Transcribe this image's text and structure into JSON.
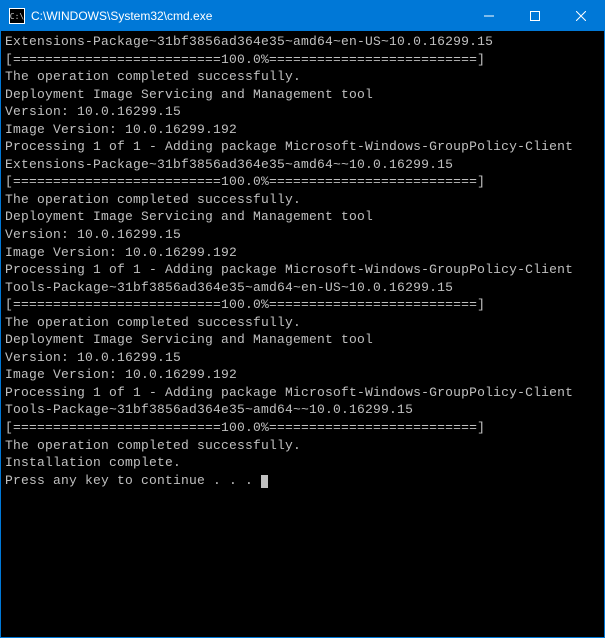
{
  "titlebar": {
    "icon_label": "C:\\",
    "title": "C:\\WINDOWS\\System32\\cmd.exe"
  },
  "terminal": {
    "lines": [
      "Extensions-Package~31bf3856ad364e35~amd64~en-US~10.0.16299.15",
      "[==========================100.0%==========================]",
      "The operation completed successfully.",
      "",
      "Deployment Image Servicing and Management tool",
      "Version: 10.0.16299.15",
      "",
      "Image Version: 10.0.16299.192",
      "",
      "Processing 1 of 1 - Adding package Microsoft-Windows-GroupPolicy-Client",
      "Extensions-Package~31bf3856ad364e35~amd64~~10.0.16299.15",
      "[==========================100.0%==========================]",
      "The operation completed successfully.",
      "",
      "Deployment Image Servicing and Management tool",
      "Version: 10.0.16299.15",
      "",
      "Image Version: 10.0.16299.192",
      "",
      "Processing 1 of 1 - Adding package Microsoft-Windows-GroupPolicy-Client",
      "Tools-Package~31bf3856ad364e35~amd64~en-US~10.0.16299.15",
      "[==========================100.0%==========================]",
      "The operation completed successfully.",
      "",
      "Deployment Image Servicing and Management tool",
      "Version: 10.0.16299.15",
      "",
      "Image Version: 10.0.16299.192",
      "",
      "Processing 1 of 1 - Adding package Microsoft-Windows-GroupPolicy-Client",
      "Tools-Package~31bf3856ad364e35~amd64~~10.0.16299.15",
      "[==========================100.0%==========================]",
      "The operation completed successfully.",
      "",
      "Installation complete.",
      ""
    ],
    "prompt_line": "Press any key to continue . . . "
  }
}
